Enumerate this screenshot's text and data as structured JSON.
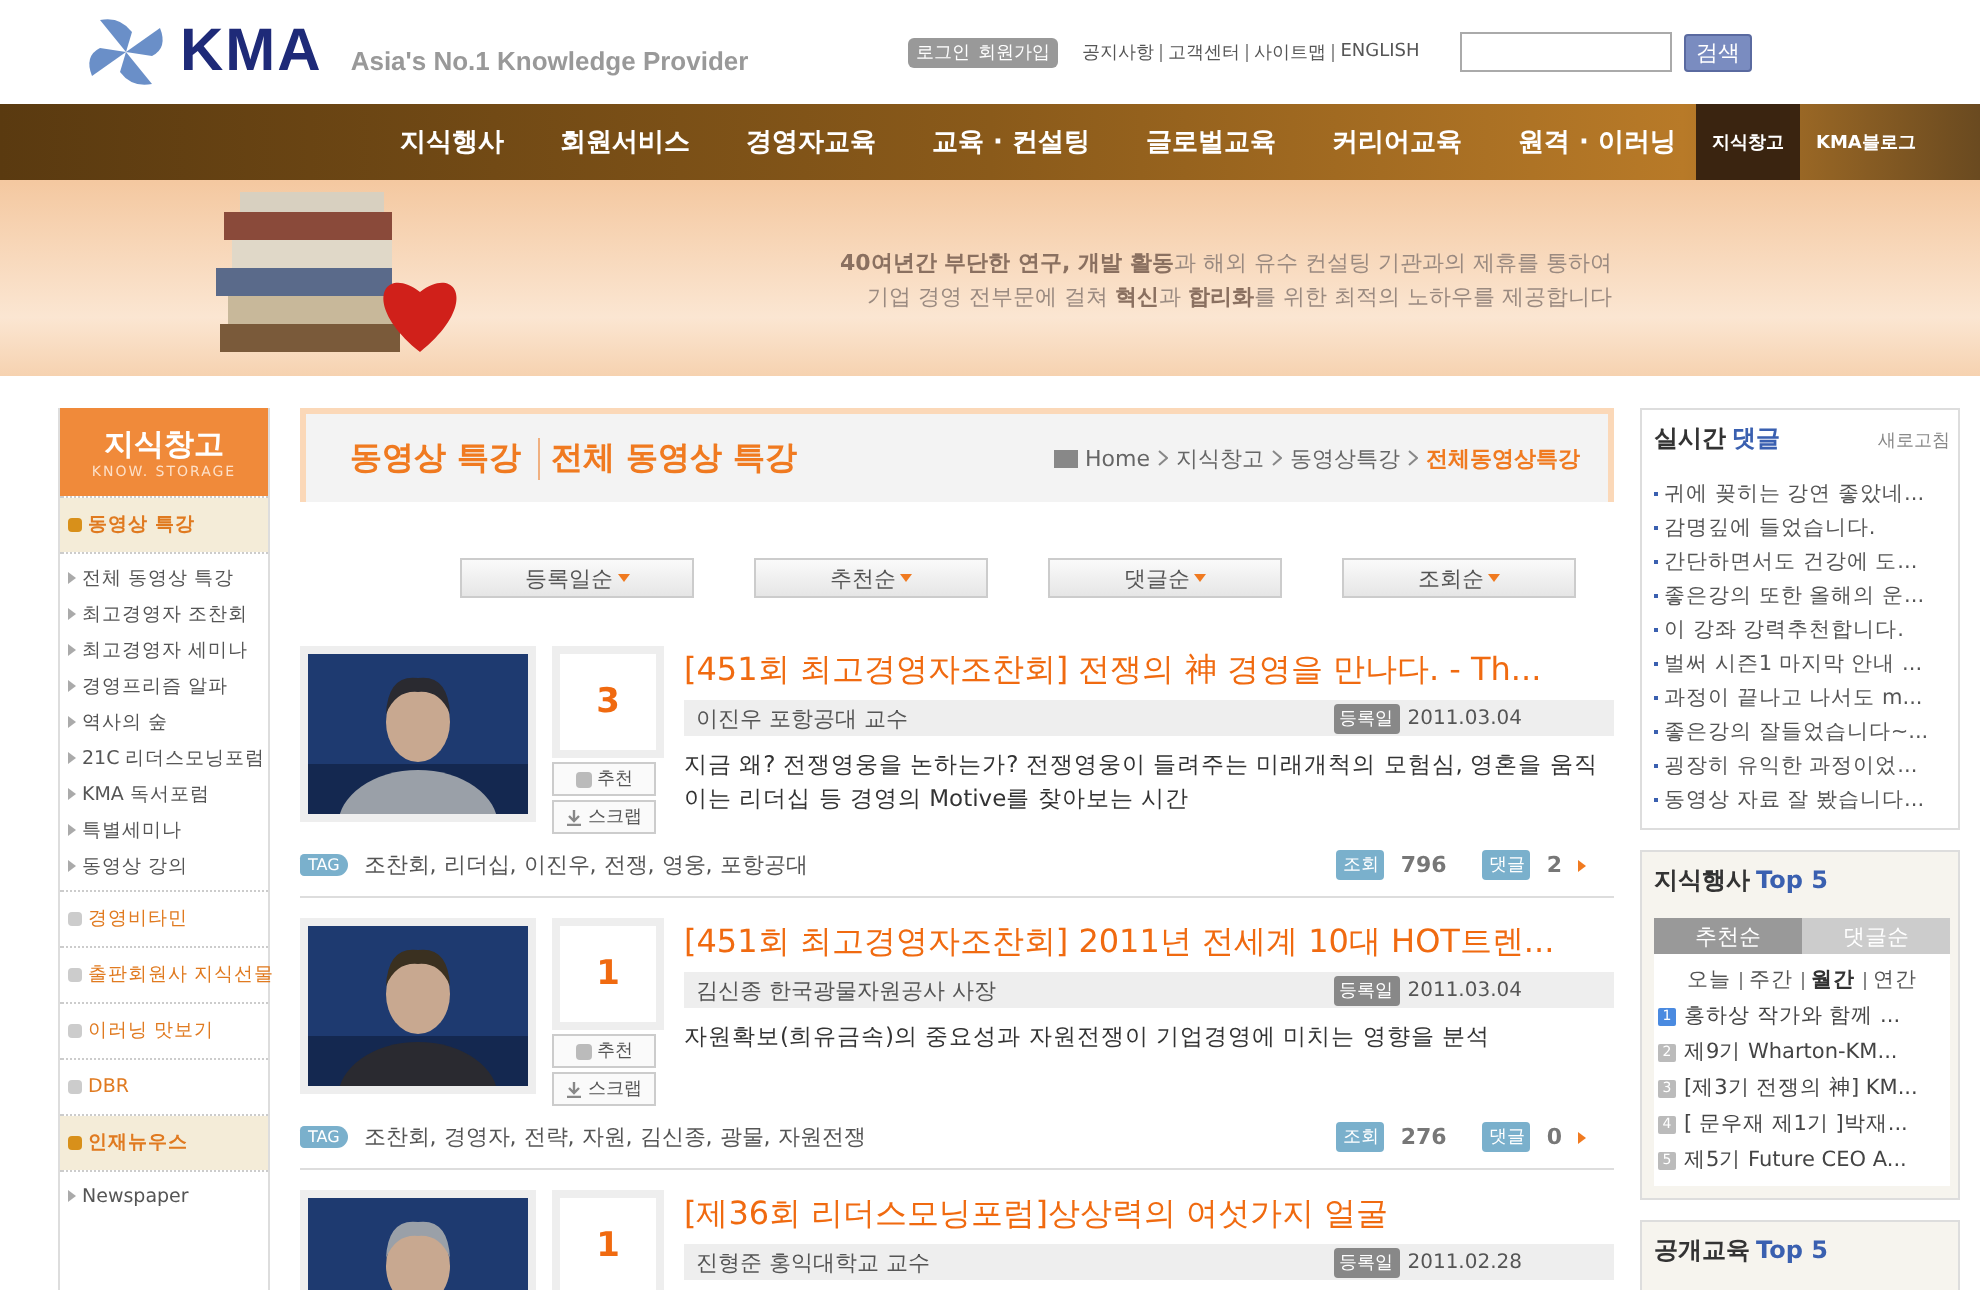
{
  "header": {
    "logo": "KMA",
    "tagline": "Asia's No.1 Knowledge Provider",
    "auth_buttons": [
      "로그인",
      "회원가입"
    ],
    "util_links": [
      "공지사항",
      "고객센터",
      "사이트맵",
      "ENGLISH"
    ],
    "search": {
      "button": "검색"
    }
  },
  "nav": {
    "main": [
      "지식행사",
      "회원서비스",
      "경영자교육",
      "교육 · 컨설팅",
      "글로벌교육",
      "커리어교육",
      "원격 · 이러닝"
    ],
    "side": [
      {
        "label": "지식창고",
        "selected": true
      },
      {
        "label": "KMA블로그",
        "selected": false
      }
    ]
  },
  "banner": {
    "lines": [
      "**40여년간 부단한 연구, 개발 활동**과 해외 유수 컨설팅 기관과의 제휴를 통하여",
      "기업 경영 전부문에 걸쳐 **혁신**과 **합리화**를 위한 최적의 노하우를 제공합니다"
    ]
  },
  "sidebar": {
    "title": "지식창고",
    "subtitle": "KNOW. STORAGE",
    "sections": [
      {
        "label": "동영상 특강",
        "selected": true,
        "children": [
          "전체 동영상 특강",
          "최고경영자 조찬회",
          "최고경영자 세미나",
          "경영프리즘 알파",
          "역사의 숲",
          "21C 리더스모닝포럼",
          "KMA 독서포럼",
          "특별세미나",
          "동영상 강의"
        ]
      },
      {
        "label": "경영비타민",
        "selected": false
      },
      {
        "label": "출판회원사 지식선물",
        "selected": false
      },
      {
        "label": "이러닝 맛보기",
        "selected": false
      },
      {
        "label": "DBR",
        "selected": false
      },
      {
        "label": "인재뉴우스",
        "selected": true,
        "children": [
          "Newspaper"
        ]
      }
    ]
  },
  "main": {
    "title": "동영상 특강",
    "subtitle": "전체 동영상 특강",
    "breadcrumb": [
      {
        "label": "Home",
        "selected": false
      },
      {
        "label": "지식창고",
        "selected": false
      },
      {
        "label": "동영상특강",
        "selected": false
      },
      {
        "label": "전체동영상특강",
        "selected": true
      }
    ],
    "sort_buttons": [
      "등록일순",
      "추천순",
      "댓글순",
      "조회순"
    ],
    "videos": [
      {
        "count": "3",
        "title": "[451회 최고경영자조찬회] 전쟁의 神 경영을 만나다. - Th...",
        "speaker": "이진우 포항공대 교수",
        "date_label": "등록일",
        "date": "2011.03.04",
        "recommend": "추천",
        "scrap": "스크랩",
        "description": "지금 왜? 전쟁영웅을 논하는가? 전쟁영웅이 들려주는 미래개척의 모험심, 영혼을 움직이는 리더십 등 경영의 Motive를 찾아보는 시간",
        "tag_label": "TAG",
        "tags": "조찬회, 리더십, 이진우, 전쟁, 영웅, 포항공대",
        "views_label": "조회",
        "views": "796",
        "comments_label": "댓글",
        "comments": "2"
      },
      {
        "count": "1",
        "title": "[451회 최고경영자조찬회] 2011년 전세계 10대 HOT트렌...",
        "speaker": "김신종 한국광물자원공사 사장",
        "date_label": "등록일",
        "date": "2011.03.04",
        "recommend": "추천",
        "scrap": "스크랩",
        "description": "자원확보(희유금속)의 중요성과 자원전쟁이 기업경영에 미치는 영향을 분석",
        "tag_label": "TAG",
        "tags": "조찬회, 경영자, 전략, 자원, 김신종, 광물, 자원전쟁",
        "views_label": "조회",
        "views": "276",
        "comments_label": "댓글",
        "comments": "0"
      },
      {
        "count": "1",
        "title": "[제36회 리더스모닝포럼]상상력의 여섯가지 얼굴",
        "speaker": "진형준 홍익대학교 교수",
        "date_label": "등록일",
        "date": "2011.02.28"
      }
    ]
  },
  "realtime": {
    "title": "실시간",
    "title_highlight": "댓글",
    "refresh": "새로고침",
    "comments": [
      "귀에 꽂히는 강연 좋았네...",
      "감명깊에 들었습니다.",
      "간단하면서도 건강에 도...",
      "좋은강의 또한 올해의 운...",
      "이 강좌 강력추천합니다.",
      "벌써 시즌1 마지막 안내 ...",
      "과정이 끝나고 나서도 m...",
      "좋은강의 잘들었습니다~...",
      "굉장히 유익한 과정이었...",
      "동영상 자료 잘 봤습니다..."
    ]
  },
  "top5": {
    "title": "지식행사",
    "title_highlight": "Top 5",
    "tabs": [
      {
        "label": "추천순",
        "selected": true
      },
      {
        "label": "댓글순",
        "selected": false
      }
    ],
    "periods": [
      {
        "label": "오늘",
        "selected": false
      },
      {
        "label": "주간",
        "selected": false
      },
      {
        "label": "월간",
        "selected": true
      },
      {
        "label": "연간",
        "selected": false
      }
    ],
    "items": [
      {
        "rank": "1",
        "text": "홍하상 작가와 함께 ...",
        "selected": true
      },
      {
        "rank": "2",
        "text": "제9기 Wharton-KM...",
        "selected": false
      },
      {
        "rank": "3",
        "text": "[제3기 전쟁의 神] KM...",
        "selected": false
      },
      {
        "rank": "4",
        "text": "[ 문우재 제1기 ]박재...",
        "selected": false
      },
      {
        "rank": "5",
        "text": "제5기 Future CEO A...",
        "selected": false
      }
    ]
  },
  "top5_education": {
    "title": "공개교육",
    "title_highlight": "Top 5"
  }
}
